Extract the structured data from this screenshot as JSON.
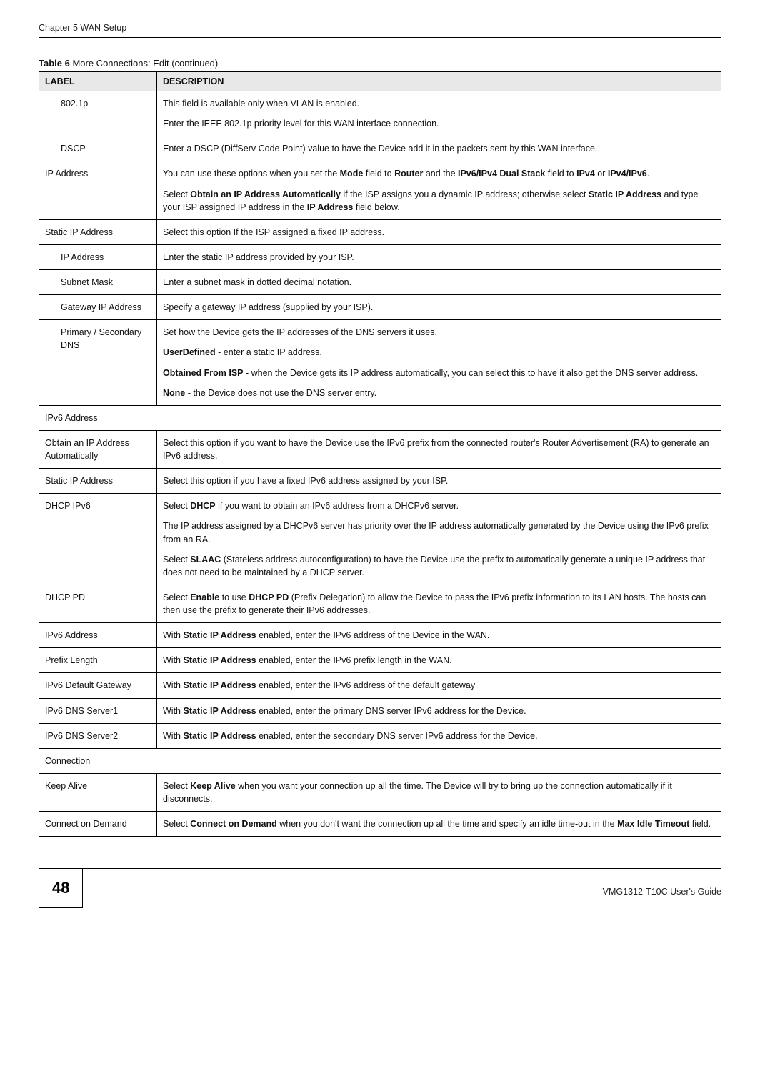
{
  "running_header": "Chapter 5 WAN Setup",
  "caption_strong": "Table 6",
  "caption_rest": "   More Connections: Edit (continued)",
  "headers": {
    "label": "LABEL",
    "description": "DESCRIPTION"
  },
  "rows": {
    "r8021p": {
      "label": "802.1p",
      "p1": "This field is available only when VLAN is enabled.",
      "p2": "Enter the IEEE 802.1p priority level for this WAN interface connection."
    },
    "rdscp": {
      "label": "DSCP",
      "p1": "Enter a DSCP (DiffServ Code Point) value to have the Device add it in the packets sent by this WAN interface."
    },
    "ripaddr": {
      "label": "IP Address",
      "p1a": "You can use these options when you set the ",
      "p1b": "Mode",
      "p1c": " field to ",
      "p1d": "Router",
      "p1e": " and the ",
      "p1f": "IPv6/IPv4 Dual Stack",
      "p1g": " field to ",
      "p1h": "IPv4",
      "p1i": " or ",
      "p1j": "IPv4/IPv6",
      "p1k": ".",
      "p2a": "Select ",
      "p2b": "Obtain an IP Address Automatically",
      "p2c": " if the ISP assigns you a dynamic IP address; otherwise select ",
      "p2d": "Static IP Address",
      "p2e": " and type your ISP assigned IP address in the ",
      "p2f": "IP Address",
      "p2g": " field below."
    },
    "rstatic": {
      "label": "Static IP Address",
      "p1": "Select this option If the ISP assigned a fixed IP address."
    },
    "ripa": {
      "label": "IP Address",
      "p1": "Enter the static IP address provided by your ISP."
    },
    "rsub": {
      "label": "Subnet Mask",
      "p1": "Enter a subnet mask in dotted decimal notation."
    },
    "rgw": {
      "label": "Gateway IP Address",
      "p1": "Specify a gateway IP address (supplied by your ISP)."
    },
    "rdns": {
      "label": "Primary / Secondary DNS",
      "p1": "Set how the Device gets the IP addresses of the DNS servers it uses.",
      "p2b": "UserDefined",
      "p2r": " - enter a static IP address.",
      "p3b": "Obtained From ISP",
      "p3r": " - when the Device gets its IP address automatically, you can select this to have it also get the DNS server address.",
      "p4b": "None",
      "p4r": " - the Device does not use the DNS server entry."
    },
    "ripv6hdr": {
      "label": "IPv6 Address"
    },
    "robtain6": {
      "label": "Obtain an IP Address Automatically",
      "p1": "Select this option if you want to have the Device use the IPv6 prefix from the connected router's Router Advertisement (RA) to generate an IPv6 address."
    },
    "rstatic6": {
      "label": "Static IP Address",
      "p1": "Select this option if you have a fixed IPv6 address assigned by your ISP."
    },
    "rdhcp6": {
      "label": "DHCP IPv6",
      "p1a": "Select ",
      "p1b": "DHCP",
      "p1c": " if you want to obtain an IPv6 address from a DHCPv6 server.",
      "p2": "The IP address assigned by a DHCPv6 server has priority over the IP address automatically generated by the Device using the IPv6 prefix from an RA.",
      "p3a": "Select ",
      "p3b": "SLAAC",
      "p3c": " (Stateless address autoconfiguration) to have the Device use the prefix to automatically generate a unique IP address that does not need to be maintained by a DHCP server."
    },
    "rdhcppd": {
      "label": "DHCP PD",
      "p1a": "Select ",
      "p1b": "Enable",
      "p1c": " to use ",
      "p1d": "DHCP PD",
      "p1e": " (Prefix Delegation) to allow the Device to pass the IPv6 prefix information to its LAN hosts. The hosts can then use the prefix to generate their IPv6 addresses."
    },
    "ripv6addr": {
      "label": "IPv6 Address",
      "p1a": "With ",
      "p1b": "Static IP Address",
      "p1c": " enabled, enter the IPv6 address of the Device in the WAN."
    },
    "rpref": {
      "label": "Prefix Length",
      "p1a": "With ",
      "p1b": "Static IP Address",
      "p1c": " enabled, enter the IPv6 prefix length in the WAN."
    },
    "rdefgw": {
      "label": "IPv6 Default Gateway",
      "p1a": "With ",
      "p1b": "Static IP Address",
      "p1c": " enabled, enter the IPv6 address of the default gateway"
    },
    "rdns1": {
      "label": "IPv6 DNS Server1",
      "p1a": "With ",
      "p1b": "Static IP Address",
      "p1c": " enabled, enter the primary DNS server IPv6 address for the Device."
    },
    "rdns2": {
      "label": "IPv6 DNS Server2",
      "p1a": "With ",
      "p1b": "Static IP Address",
      "p1c": " enabled, enter the secondary DNS server IPv6 address for the Device."
    },
    "rconnhdr": {
      "label": "Connection"
    },
    "rkeep": {
      "label": "Keep Alive",
      "p1a": "Select ",
      "p1b": "Keep Alive",
      "p1c": " when you want your connection up all the time. The Device will try to bring up the connection automatically if it disconnects."
    },
    "rcod": {
      "label": "Connect on Demand",
      "p1a": "Select ",
      "p1b": "Connect on Demand",
      "p1c": " when you don't want the connection up all the time and specify an idle time-out in the ",
      "p1d": "Max Idle Timeout",
      "p1e": " field."
    }
  },
  "footer": {
    "page_number": "48",
    "guide": "VMG1312-T10C User's Guide"
  }
}
